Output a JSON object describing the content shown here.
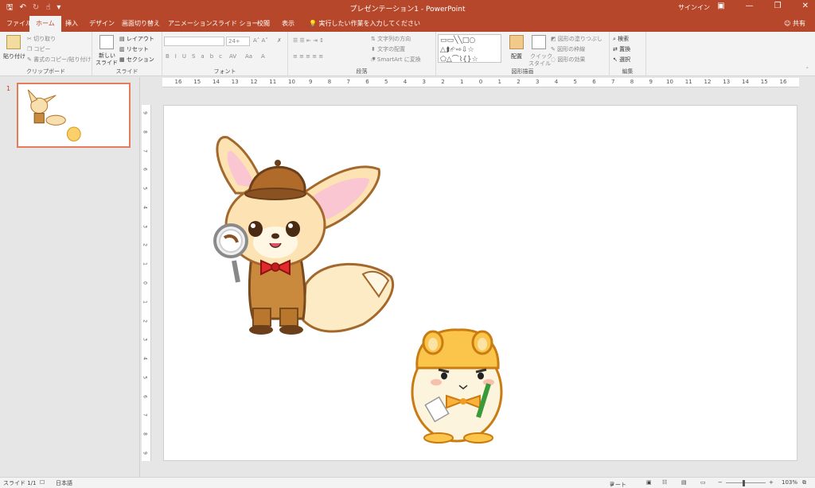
{
  "titlebar": {
    "title": "プレゼンテーション1 - PowerPoint",
    "signin": "サインイン",
    "qat_icons": [
      "save-icon",
      "undo-icon",
      "redo-icon",
      "touch-mode-icon",
      "customize-icon"
    ],
    "window_buttons": [
      "minimize-icon",
      "restore-icon",
      "close-icon"
    ],
    "color": "#b7472a"
  },
  "tabs": {
    "file": "ファイル",
    "home": "ホーム",
    "insert": "挿入",
    "design": "デザイン",
    "transitions": "画面切り替え",
    "animations": "アニメーション",
    "slideshow": "スライド ショー",
    "review": "校閲",
    "view": "表示",
    "tellme": "実行したい作業を入力してください",
    "share": "共有"
  },
  "ribbon": {
    "clipboard": {
      "paste": "貼り付け",
      "cut": "切り取り",
      "copy": "コピー",
      "format_painter": "書式のコピー/貼り付け",
      "label": "クリップボード"
    },
    "slides": {
      "new_slide": "新しい",
      "new_slide2": "スライド",
      "layout": "レイアウト",
      "reset": "リセット",
      "section": "セクション",
      "label": "スライド"
    },
    "font": {
      "size": "24+",
      "label": "フォント"
    },
    "paragraph": {
      "text_direction": "文字列の方向",
      "align_text": "文字の配置",
      "smartart": "SmartArt に変換",
      "label": "段落"
    },
    "drawing": {
      "arrange": "配置",
      "quick_styles": "クイック",
      "quick_styles2": "スタイル",
      "shape_fill": "図形の塗りつぶし",
      "shape_outline": "図形の枠線",
      "shape_effects": "図形の効果",
      "label": "図形描画"
    },
    "editing": {
      "find": "検索",
      "replace": "置換",
      "select": "選択",
      "label": "編集"
    }
  },
  "slides_pane": {
    "slide_number": "1"
  },
  "ruler": {
    "horizontal": [
      "16",
      "15",
      "14",
      "13",
      "12",
      "11",
      "10",
      "9",
      "8",
      "7",
      "6",
      "5",
      "4",
      "3",
      "2",
      "1",
      "0",
      "1",
      "2",
      "3",
      "4",
      "5",
      "6",
      "7",
      "8",
      "9",
      "10",
      "11",
      "12",
      "13",
      "14",
      "15",
      "16"
    ],
    "vertical": [
      "9",
      "8",
      "7",
      "6",
      "5",
      "4",
      "3",
      "2",
      "1",
      "0",
      "1",
      "2",
      "3",
      "4",
      "5",
      "6",
      "7",
      "8",
      "9"
    ]
  },
  "statusbar": {
    "slide": "スライド 1/1",
    "language": "日本語",
    "notes": "ノート",
    "zoom": "103%"
  },
  "slide_content": {
    "images": [
      "fennec-fox-detective-illustration",
      "hamster-with-pencil-illustration"
    ]
  }
}
